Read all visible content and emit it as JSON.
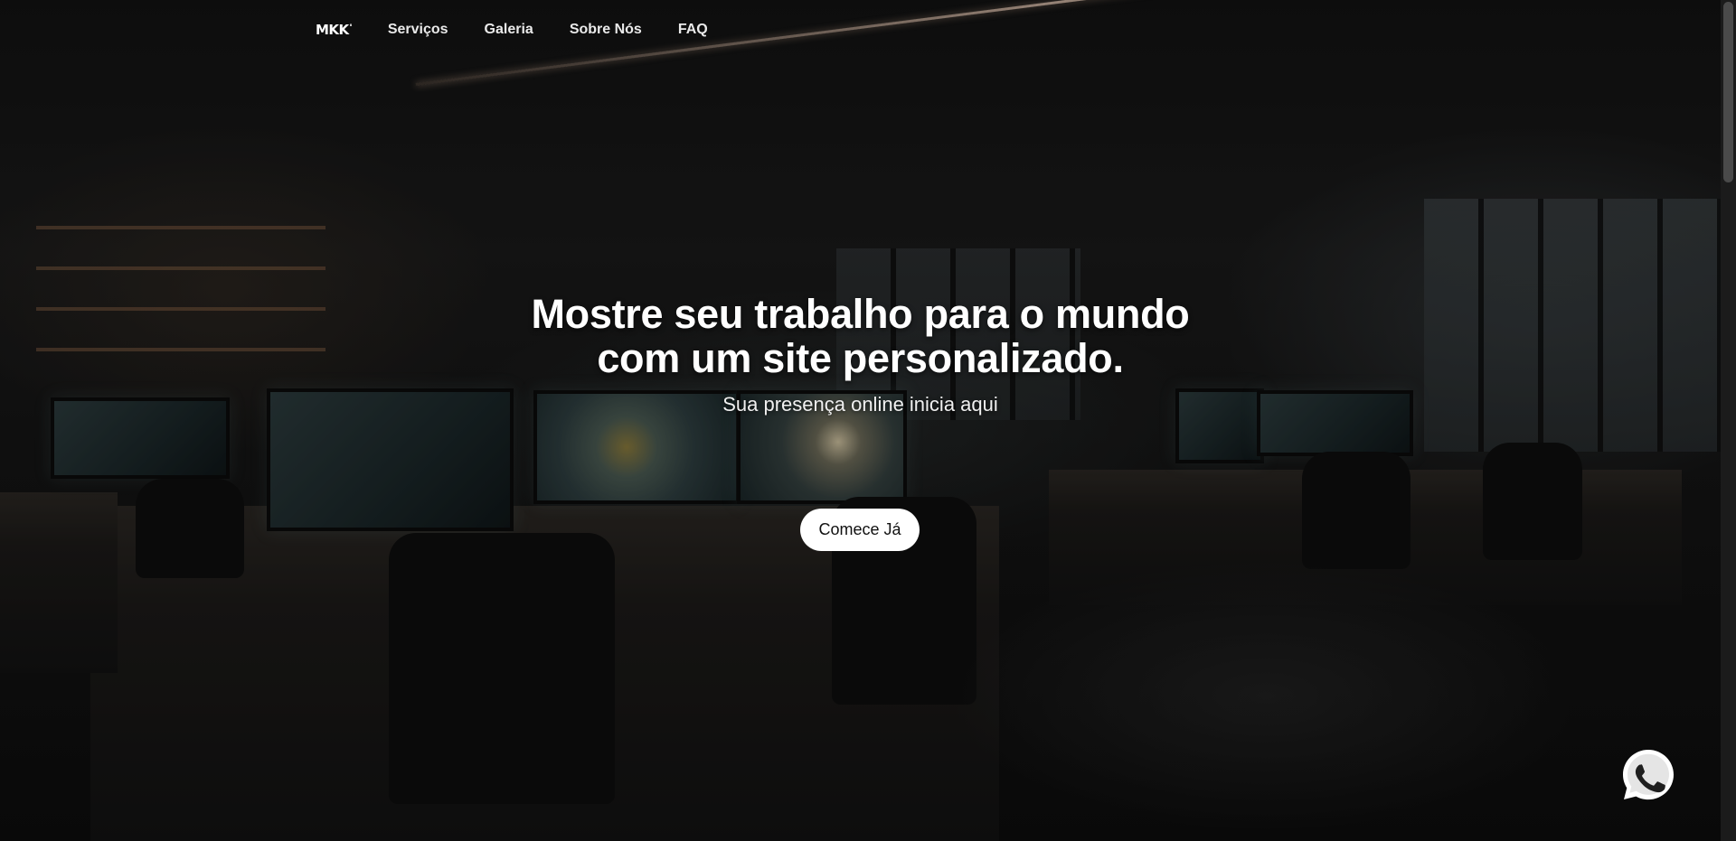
{
  "header": {
    "logo_text": "MKK",
    "logo_sup": "⁸",
    "nav_items": [
      {
        "label": "Serviços"
      },
      {
        "label": "Galeria"
      },
      {
        "label": "Sobre Nós"
      },
      {
        "label": "FAQ"
      }
    ]
  },
  "hero": {
    "title_line1": "Mostre seu trabalho para o mundo",
    "title_line2": "com um site personalizado.",
    "subtitle": "Sua presença online inicia aqui",
    "cta_label": "Comece Já"
  },
  "floating": {
    "whatsapp_icon": "whatsapp-icon",
    "whatsapp_color": "#ffffff"
  },
  "colors": {
    "background": "#0a0a0a",
    "cta_bg": "#ffffff",
    "text": "#ffffff"
  }
}
